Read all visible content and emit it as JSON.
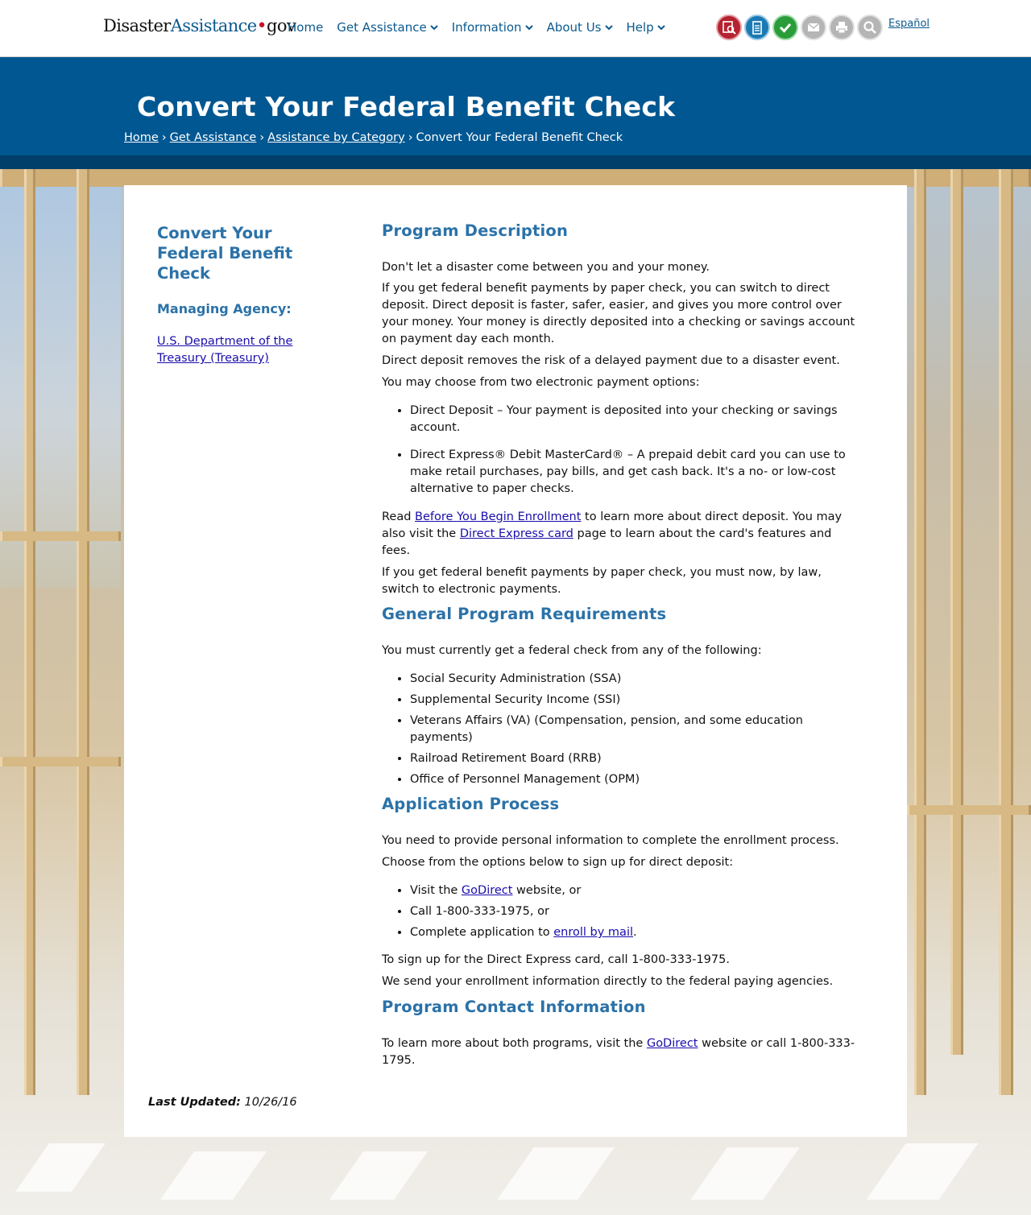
{
  "logo": {
    "part1": "Disaster",
    "part2": "Assistance",
    "part3": "gov"
  },
  "nav": {
    "home": "Home",
    "get_assistance": "Get Assistance",
    "information": "Information",
    "about_us": "About Us",
    "help": "Help"
  },
  "tool_icons": [
    {
      "name": "find-assistance-icon",
      "color": "#b52230"
    },
    {
      "name": "apply-online-icon",
      "color": "#1c7ab3"
    },
    {
      "name": "check-status-icon",
      "color": "#2a9d3a"
    },
    {
      "name": "email-icon",
      "color": "#b5b5b5"
    },
    {
      "name": "print-icon",
      "color": "#b5b5b5"
    },
    {
      "name": "search-icon",
      "color": "#b5b5b5"
    }
  ],
  "language_link": "Español",
  "page": {
    "title": "Convert Your Federal Benefit Check",
    "breadcrumb": {
      "home": "Home",
      "get_assistance": "Get Assistance",
      "category": "Assistance by Category",
      "current": "Convert Your Federal Benefit Check",
      "separator": "›"
    }
  },
  "sidebar": {
    "title": "Convert Your Federal Benefit Check",
    "agency_label": "Managing Agency:",
    "agency_link": "U.S. Department of the Treasury (Treasury)"
  },
  "content": {
    "s1_heading": "Program Description",
    "s1_p1": "Don't let a disaster come between you and your money.",
    "s1_p2": "If you get federal benefit payments by paper check, you can switch to direct deposit. Direct deposit is faster, safer, easier, and gives you more control over your money. Your money is directly deposited into a checking or savings account on payment day each month.",
    "s1_p3": "Direct deposit removes the risk of a delayed payment due to a disaster event.",
    "s1_p4": "You may choose from two electronic payment options:",
    "s1_li1": "Direct Deposit – Your payment is deposited into your checking or savings account.",
    "s1_li2": "Direct Express® Debit MasterCard® – A prepaid debit card you can use to make retail purchases, pay bills, and get cash back. It's a no- or low-cost alternative to paper checks.",
    "s1_p5_a": "Read ",
    "s1_p5_link1": "Before You Begin Enrollment",
    "s1_p5_b": " to learn more about direct deposit. You may also visit the ",
    "s1_p5_link2": "Direct Express card",
    "s1_p5_c": " page to learn about the card's features and fees.",
    "s1_p6": "If you get federal benefit payments by paper check, you must now, by law, switch to electronic payments.",
    "s2_heading": "General Program Requirements",
    "s2_p1": "You must currently get a federal check from any of the following:",
    "s2_items": [
      "Social Security Administration (SSA)",
      "Supplemental Security Income (SSI)",
      "Veterans Affairs (VA) (Compensation, pension, and some education payments)",
      "Railroad Retirement Board (RRB)",
      "Office of Personnel Management (OPM)"
    ],
    "s3_heading": "Application Process",
    "s3_p1": "You need to provide personal information to complete the enrollment process.",
    "s3_p2": "Choose from the options below to sign up for direct deposit:",
    "s3_li1_a": "Visit the ",
    "s3_li1_link": "GoDirect",
    "s3_li1_b": " website, or",
    "s3_li2": "Call 1-800-333-1975, or",
    "s3_li3_a": "Complete application to ",
    "s3_li3_link": "enroll by mail",
    "s3_li3_b": ".",
    "s3_p3": "To sign up for the Direct Express card, call 1-800-333-1975.",
    "s3_p4": "We send your enrollment information directly to the federal paying agencies.",
    "s4_heading": "Program Contact Information",
    "s4_p1_a": "To learn more about both programs, visit the ",
    "s4_p1_link": "GoDirect",
    "s4_p1_b": " website or call 1-800-333-1795."
  },
  "footer": {
    "last_updated_label": "Last Updated:",
    "last_updated_value": "10/26/16"
  }
}
